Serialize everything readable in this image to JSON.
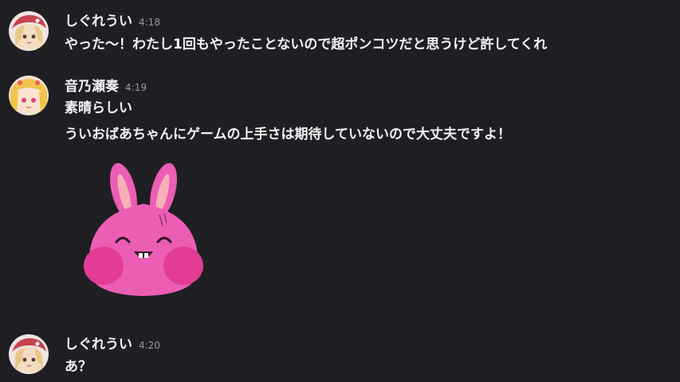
{
  "messages": [
    {
      "username": "しぐれうい",
      "time": "4:18",
      "lines": [
        "やった～！わたし1回もやったことないので超ポンコツだと思うけど許してくれ"
      ]
    },
    {
      "username": "音乃瀬奏",
      "time": "4:19",
      "lines": [
        "素晴らしい",
        "ういおばあちゃんにゲームの上手さは期待していないので大丈夫ですよ！"
      ],
      "sticker": "pink-bunny-sticker"
    },
    {
      "username": "しぐれうい",
      "time": "4:20",
      "lines": [
        "あ？"
      ]
    }
  ],
  "colors": {
    "background": "#1f1f23",
    "text": "#f2f3f5",
    "timestamp": "#949ba4",
    "sticker_pink": "#e95bb0"
  }
}
